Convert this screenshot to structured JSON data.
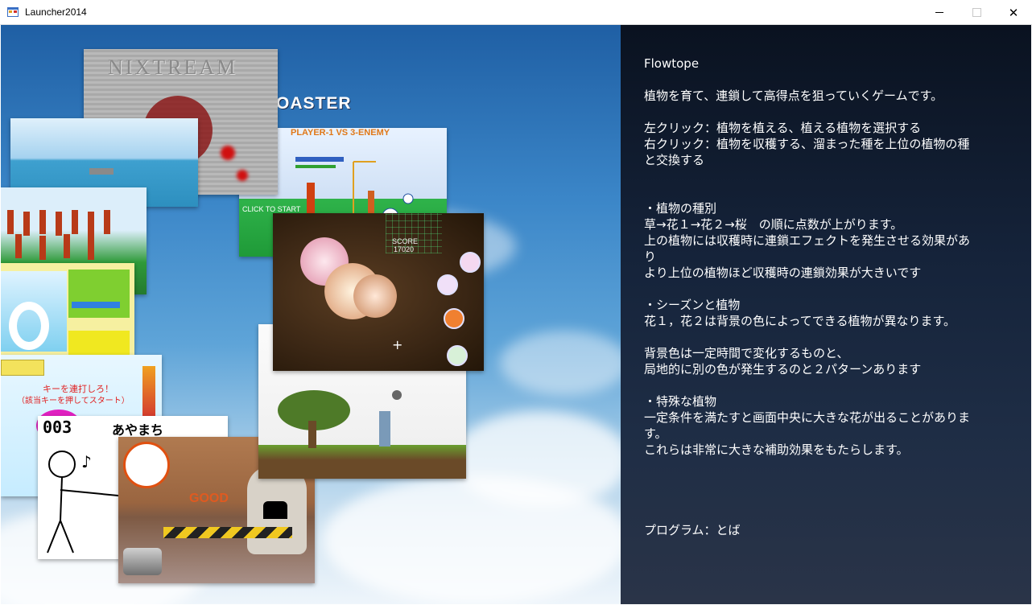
{
  "window": {
    "title": "Launcher2014",
    "minimize_glyph": "",
    "close_glyph": "✕"
  },
  "thumbnails": {
    "nixtream": {
      "title": "NIXTREAM"
    },
    "coaster": {
      "title": "OASTER",
      "subtitle": "PLAYER-1 VS 3-ENEMY",
      "start": "CLICK TO START"
    },
    "flowtope": {
      "score_label": "SCORE",
      "score_value": "17020"
    },
    "rapid": {
      "line1": "キーを連打しろ！",
      "line2": "（該当キーを押してスタート）"
    },
    "ayamachi": {
      "title": "あやまち",
      "counter": "003"
    },
    "clock_game": {
      "good": "GOOD"
    }
  },
  "description": {
    "lines": [
      "Flowtope",
      "",
      "植物を育て、連鎖して高得点を狙っていくゲームです。",
      "",
      "左クリック：植物を植える、植える植物を選択する",
      "右クリック：植物を収穫する、溜まった種を上位の植物の種",
      "と交換する",
      "",
      "",
      "・植物の種別",
      "草→花１→花２→桜　の順に点数が上がります。",
      "上の植物には収穫時に連鎖エフェクトを発生させる効果があ",
      "り",
      "より上位の植物ほど収穫時の連鎖効果が大きいです",
      "",
      "・シーズンと植物",
      "花１，花２は背景の色によってできる植物が異なります。",
      "",
      "背景色は一定時間で変化するものと、",
      "局地的に別の色が発生するのと２パターンあります",
      "",
      "・特殊な植物",
      "一定条件を満たすと画面中央に大きな花が出ることがありま",
      "す。",
      "これらは非常に大きな補助効果をもたらします。"
    ],
    "credit": "プログラム：とば"
  },
  "icons": {
    "app": "app-icon",
    "minimize": "minimize-icon",
    "maximize": "maximize-icon",
    "close": "close-icon"
  }
}
